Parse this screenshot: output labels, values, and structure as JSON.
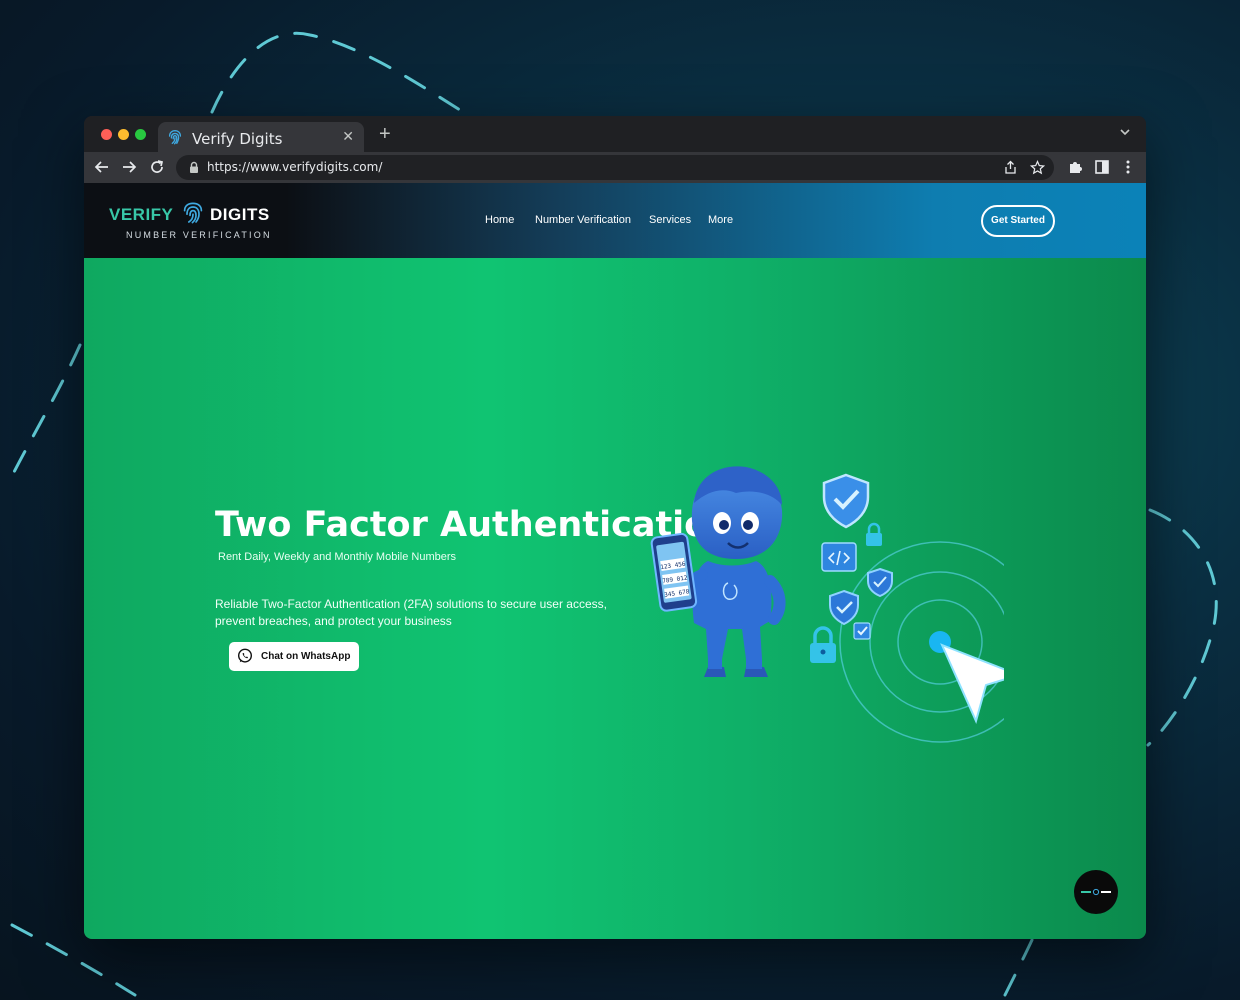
{
  "browser": {
    "tab_title": "Verify Digits",
    "url": "https://www.verifydigits.com/",
    "icons": [
      "back-icon",
      "forward-icon",
      "reload-icon",
      "lock-icon",
      "share-icon",
      "star-icon",
      "extensions-icon",
      "sidebar-icon",
      "menu-icon"
    ]
  },
  "header": {
    "logo_verify": "VERIFY",
    "logo_digits": "DIGITS",
    "logo_sub": "NUMBER VERIFICATION",
    "nav": [
      "Home",
      "Number Verification",
      "Services",
      "More"
    ],
    "cta": "Get Started"
  },
  "hero": {
    "title": "Two Factor Authentication",
    "subtitle": "Rent Daily, Weekly and Monthly Mobile Numbers",
    "description": "Reliable Two-Factor Authentication (2FA) solutions to secure user access, prevent breaches, and protect your business",
    "whatsapp_label": "Chat on WhatsApp",
    "phone_codes": [
      "123 456",
      "789 012",
      "345 678"
    ]
  },
  "colors": {
    "accent_green": "#10c472",
    "header_blue": "#0b82b8",
    "logo_teal": "#38c8a8"
  }
}
